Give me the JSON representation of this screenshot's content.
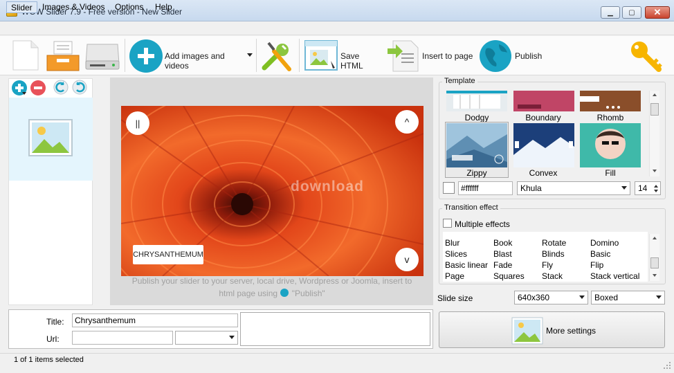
{
  "window": {
    "title": "WOW Slider 7.9 - Free version - New Slider",
    "close_glyph": "✕",
    "min_glyph": "▁",
    "max_glyph": "▢"
  },
  "menu": {
    "items": [
      "Slider",
      "Images & Videos",
      "Options",
      "Help"
    ]
  },
  "toolbar": {
    "add_images_label": "Add images and videos",
    "save_html_label": "Save HTML",
    "insert_label": "Insert to page",
    "publish_label": "Publish"
  },
  "preview": {
    "caption": "CHRYSANTHEMUM",
    "watermark": "download",
    "hint_line1": "Publish your slider to your server, local drive, Wordpress or Joomla, insert to",
    "hint_line2": "html page using",
    "hint_publish": "\"Publish\"",
    "pause_glyph": "||",
    "up_glyph": "^",
    "down_glyph": "v"
  },
  "template": {
    "group_title": "Template",
    "items": [
      "Dodgy",
      "Boundary",
      "Rhomb",
      "Zippy",
      "Convex",
      "Fill"
    ],
    "color_value": "#ffffff",
    "font_value": "Khula",
    "font_size": "14"
  },
  "transition": {
    "group_title": "Transition effect",
    "multiple_label": "Multiple effects",
    "col1": [
      "Blur",
      "Slices",
      "Basic linear",
      "Page"
    ],
    "col2": [
      "Book",
      "Blast",
      "Fade",
      "Squares"
    ],
    "col3": [
      "Rotate",
      "Blinds",
      "Fly",
      "Stack"
    ],
    "col4": [
      "Domino",
      "Basic",
      "Flip",
      "Stack vertical"
    ]
  },
  "slide_size": {
    "label": "Slide size",
    "size_value": "640x360",
    "mode_value": "Boxed"
  },
  "more_settings_label": "More settings",
  "fields": {
    "title_label": "Title:",
    "title_value": "Chrysanthemum",
    "url_label": "Url:",
    "url_value": "",
    "target_value": ""
  },
  "status": {
    "text": "1 of 1 items selected"
  },
  "colors": {
    "accent": "#1aa3c4",
    "titlebar": "#cfe0f2",
    "flower": "#e2461a"
  }
}
